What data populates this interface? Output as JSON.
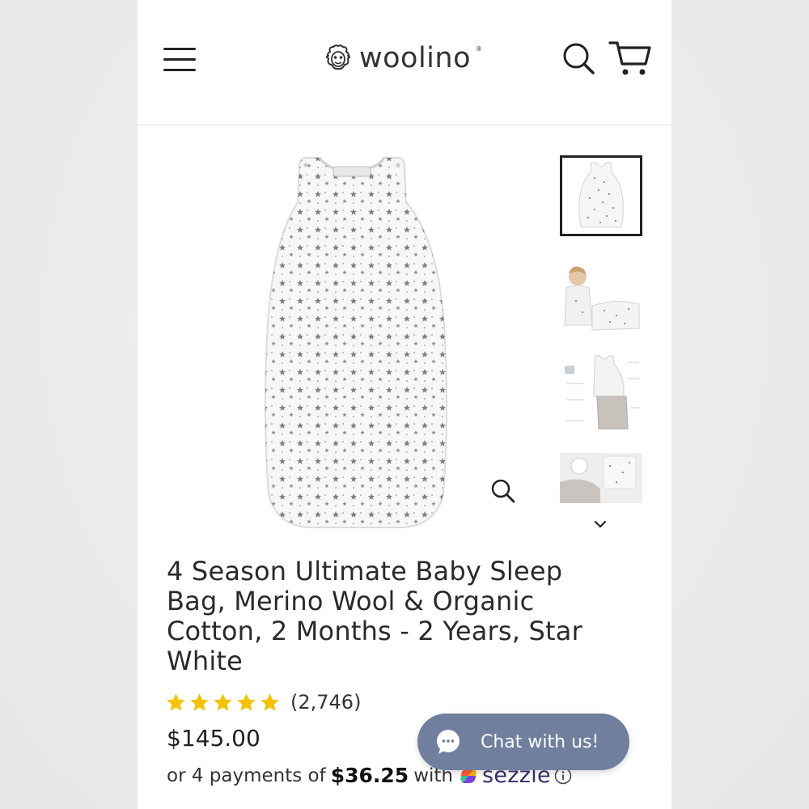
{
  "header": {
    "brand": "woolino",
    "icons": {
      "menu": "hamburger-menu-icon",
      "search": "search-icon",
      "cart": "cart-icon"
    }
  },
  "gallery": {
    "main_image_alt": "star-print sleep bag",
    "thumbnails": [
      {
        "name": "sleep-bag-front",
        "active": true
      },
      {
        "name": "baby-in-sleep-bag",
        "active": false
      },
      {
        "name": "features-diagram",
        "active": false
      },
      {
        "name": "fabric-detail",
        "active": false
      }
    ]
  },
  "product": {
    "title_lines": [
      "4 Season Ultimate Baby Sleep",
      "Bag, Merino Wool & Organic",
      "Cotton, 2 Months - 2 Years, Star",
      "White"
    ],
    "rating": 5,
    "review_count": "(2,746)",
    "price": "$145.00",
    "installment_prefix": "or 4 payments of",
    "installment_amount": "$36.25",
    "installment_suffix": "with",
    "payment_provider": "sezzle"
  },
  "chat": {
    "label": "Chat with us!"
  },
  "colors": {
    "star": "#f6c200",
    "chat_bg": "#6f7f9d",
    "sezzle_text": "#382e6b",
    "text": "#2a2a2a"
  }
}
